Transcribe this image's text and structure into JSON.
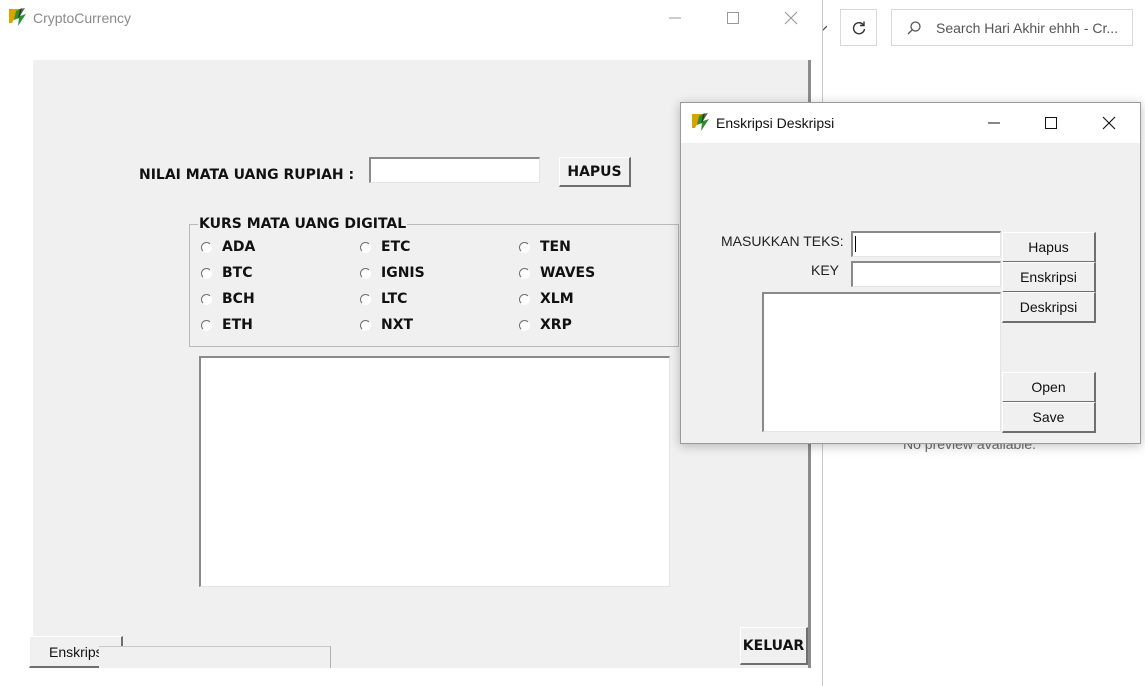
{
  "explorer": {
    "search_placeholder": "Search Hari Akhir ehhh - Cr...",
    "preview_text": "No preview available."
  },
  "main_window": {
    "title": "CryptoCurrency",
    "rupiah_label": "NILAI MATA UANG RUPIAH :",
    "rupiah_value": "",
    "hapus_label": "HAPUS",
    "group_title": "KURS MATA UANG DIGITAL",
    "currencies": {
      "col1": [
        "ADA",
        "BTC",
        "BCH",
        "ETH"
      ],
      "col2": [
        "ETC",
        "IGNIS",
        "LTC",
        "NXT"
      ],
      "col3": [
        "TEN",
        "WAVES",
        "XLM",
        "XRP"
      ]
    },
    "output_text": "",
    "keluar_label": "KELUAR",
    "enskripsi_button_label": "Enskrips"
  },
  "enc_window": {
    "title": "Enskripsi Deskripsi",
    "text_label": "MASUKKAN TEKS:",
    "key_label": "KEY",
    "text_value": "",
    "key_value": "",
    "output_text": "",
    "buttons": {
      "hapus": "Hapus",
      "enskripsi": "Enskripsi",
      "deskripsi": "Deskripsi",
      "open": "Open",
      "save": "Save"
    }
  },
  "icons": {
    "app_icon": "delphi-app-icon",
    "minimize": "minimize-icon",
    "maximize": "maximize-icon",
    "close": "close-icon",
    "refresh": "refresh-icon",
    "search": "search-icon"
  }
}
